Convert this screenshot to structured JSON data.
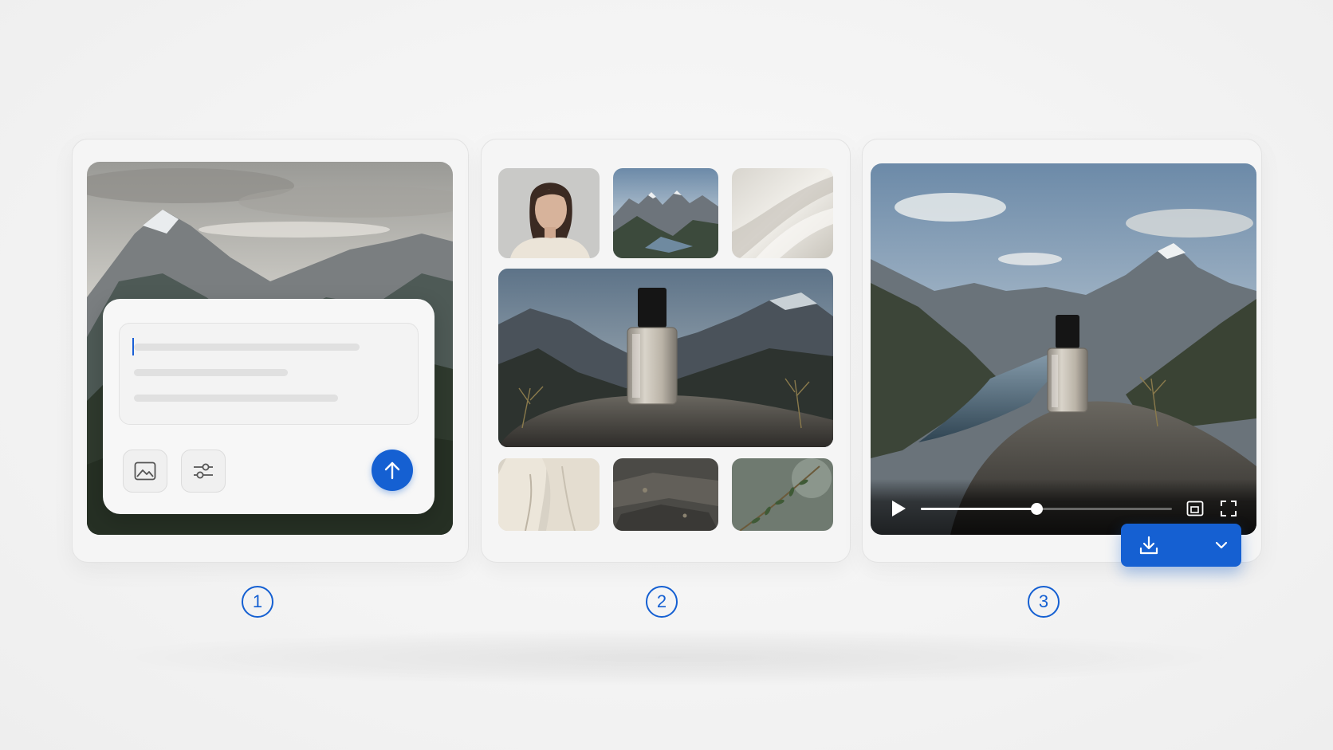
{
  "steps": [
    {
      "number": "1",
      "description_hidden": ""
    },
    {
      "number": "2"
    },
    {
      "number": "3"
    }
  ],
  "colors": {
    "accent": "#1560d2",
    "panel_bg": "#f5f5f5",
    "page_bg": "#f4f4f4",
    "skeleton": "#e0e0e0"
  },
  "panel1": {
    "prompt_input": {
      "value": "",
      "placeholder_lines": 3
    },
    "tools": [
      "image-icon",
      "sliders-icon"
    ],
    "send_icon": "arrow-up-icon"
  },
  "panel2": {
    "grid": {
      "top_row": [
        "woman-portrait",
        "mountain-lake",
        "fabric-drape"
      ],
      "hero": "perfume-bottle-on-rock",
      "bottom_row": [
        "linen-dress",
        "rock-texture",
        "plant-sprig"
      ]
    }
  },
  "panel3": {
    "video": {
      "progress": 0.46,
      "icons": [
        "play-icon",
        "picture-in-picture-icon",
        "fullscreen-icon"
      ]
    },
    "download": {
      "icons": [
        "download-icon",
        "chevron-down-icon"
      ]
    }
  }
}
